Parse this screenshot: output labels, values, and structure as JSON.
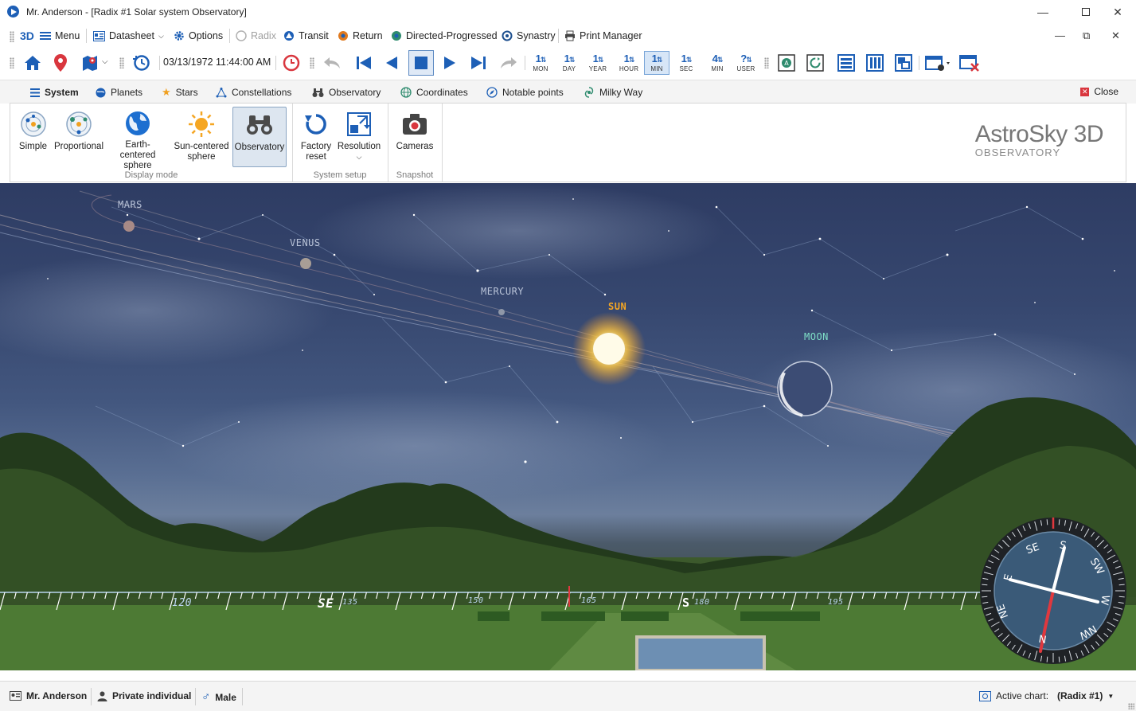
{
  "window": {
    "title": "Mr. Anderson - [Radix #1 Solar system Observatory]"
  },
  "menubar": {
    "view_mode": "3D",
    "items": [
      {
        "label": "Menu",
        "icon": "hamburger-icon"
      },
      {
        "label": "Datasheet",
        "icon": "datasheet-icon"
      },
      {
        "label": "Options",
        "icon": "gear-icon"
      },
      {
        "label": "Radix",
        "icon": "radio-icon",
        "disabled": true
      },
      {
        "label": "Transit",
        "icon": "transit-icon"
      },
      {
        "label": "Return",
        "icon": "return-icon"
      },
      {
        "label": "Directed-Progressed",
        "icon": "progressed-icon"
      },
      {
        "label": "Synastry",
        "icon": "synastry-icon"
      },
      {
        "label": "Print Manager",
        "icon": "printer-icon"
      }
    ]
  },
  "toolbar": {
    "datetime": "03/13/1972 11:44:00 AM",
    "steps": [
      {
        "value": "1",
        "unit": "MON"
      },
      {
        "value": "1",
        "unit": "DAY"
      },
      {
        "value": "1",
        "unit": "YEAR"
      },
      {
        "value": "1",
        "unit": "HOUR"
      },
      {
        "value": "1",
        "unit": "MIN",
        "active": true
      },
      {
        "value": "1",
        "unit": "SEC"
      },
      {
        "value": "4",
        "unit": "MIN"
      },
      {
        "value": "?",
        "unit": "USER"
      }
    ]
  },
  "ribbon": {
    "tabs": [
      {
        "label": "System",
        "icon": "hamburger-icon",
        "active": true
      },
      {
        "label": "Planets",
        "icon": "planet-icon"
      },
      {
        "label": "Stars",
        "icon": "star-icon"
      },
      {
        "label": "Constellations",
        "icon": "constellation-icon"
      },
      {
        "label": "Observatory",
        "icon": "binoculars-icon"
      },
      {
        "label": "Coordinates",
        "icon": "globe-icon"
      },
      {
        "label": "Notable points",
        "icon": "compass-icon"
      },
      {
        "label": "Milky Way",
        "icon": "galaxy-icon"
      }
    ],
    "close_label": "Close",
    "groups": [
      {
        "label": "Display mode",
        "buttons": [
          {
            "label": "Simple",
            "icon": "orbit-simple-icon"
          },
          {
            "label": "Proportional",
            "icon": "orbit-proportional-icon"
          },
          {
            "label": "Earth-centered sphere",
            "line1": "Earth-centered",
            "line2": "sphere",
            "icon": "earth-icon"
          },
          {
            "label": "Sun-centered sphere",
            "line1": "Sun-centered",
            "line2": "sphere",
            "icon": "sun-icon"
          },
          {
            "label": "Observatory",
            "icon": "binoculars-icon",
            "active": true
          }
        ]
      },
      {
        "label": "System setup",
        "buttons": [
          {
            "label": "Factory reset",
            "line1": "Factory",
            "line2": "reset",
            "icon": "reset-icon"
          },
          {
            "label": "Resolution",
            "icon": "resolution-icon"
          }
        ]
      },
      {
        "label": "Snapshot",
        "buttons": [
          {
            "label": "Cameras",
            "icon": "camera-icon"
          }
        ]
      }
    ],
    "brand": {
      "main": "AstroSky 3D",
      "sub": "OBSERVATORY"
    }
  },
  "sky": {
    "bodies": [
      {
        "name": "MARS",
        "color": "#b9c3d8"
      },
      {
        "name": "VENUS",
        "color": "#b9c3d8"
      },
      {
        "name": "MERCURY",
        "color": "#b9c3d8"
      },
      {
        "name": "SUN",
        "color": "#f5a623"
      },
      {
        "name": "MOON",
        "color": "#7fe0c8"
      }
    ],
    "horizon": {
      "ticks": [
        {
          "label": "120"
        },
        {
          "label": "SE"
        },
        {
          "label": "135"
        },
        {
          "label": "150"
        },
        {
          "label": "165"
        },
        {
          "label": "S"
        },
        {
          "label": "180"
        },
        {
          "label": "195"
        }
      ]
    },
    "compass": {
      "labels": [
        "SE",
        "S",
        "SW",
        "W",
        "NW",
        "N",
        "NE",
        "E"
      ]
    }
  },
  "statusbar": {
    "name": "Mr. Anderson",
    "type": "Private individual",
    "gender": "Male",
    "active_chart_label": "Active chart:",
    "active_chart_value": "(Radix #1)"
  }
}
